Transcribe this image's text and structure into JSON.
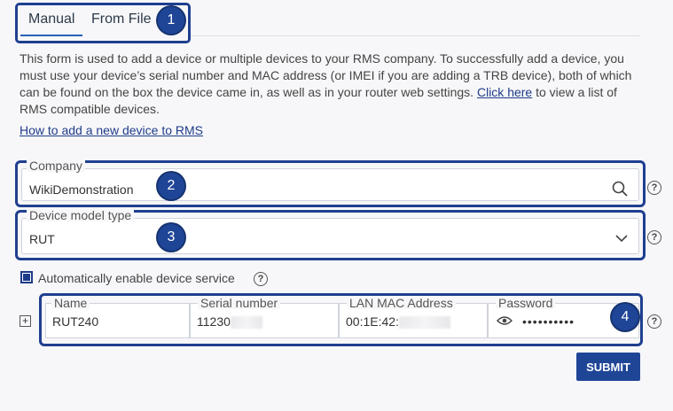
{
  "tabs": [
    {
      "label": "Manual",
      "active": true
    },
    {
      "label": "From File",
      "active": false
    }
  ],
  "badges": [
    "1",
    "2",
    "3",
    "4"
  ],
  "description": {
    "text_before": "This form is used to add a device or multiple devices to your RMS company. To successfully add a device, you must use your device’s serial number and MAC address (or IMEI if you are adding a TRB device), both of which can be found on the box the device came in, as well as in your router web settings. ",
    "link": "Click here",
    "text_after": " to view a list of RMS compatible devices."
  },
  "howto_link": "How to add a new device to RMS",
  "company": {
    "legend": "Company",
    "value": "WikiDemonstration",
    "icon": "search-icon"
  },
  "device_model": {
    "legend": "Device model type",
    "value": "RUT",
    "icon": "chevron-down-icon"
  },
  "auto_enable": {
    "label": "Automatically enable device service",
    "checked": true
  },
  "device_row": {
    "name": {
      "legend": "Name",
      "value": "RUT240"
    },
    "serial": {
      "legend": "Serial number",
      "value": "11230"
    },
    "mac": {
      "legend": "LAN MAC Address",
      "value": "00:1E:42:"
    },
    "password": {
      "legend": "Password",
      "value": "••••••••••"
    }
  },
  "add_row_symbol": "+",
  "help_symbol": "?",
  "submit_label": "SUBMIT",
  "colors": {
    "accent": "#1f4597",
    "link": "#1f3c8a",
    "background": "#f7f7f9"
  }
}
